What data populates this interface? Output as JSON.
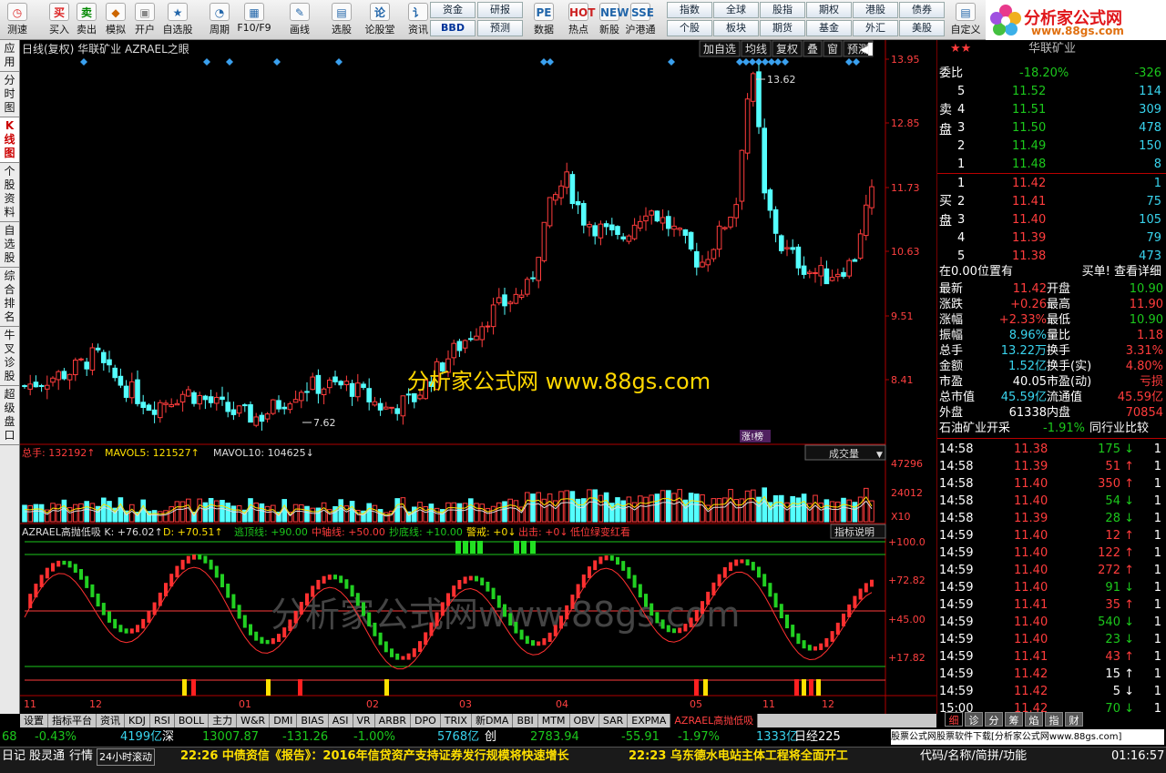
{
  "toolbar": {
    "buttons": [
      "测速",
      "买入",
      "卖出",
      "模拟",
      "开户",
      "自选股",
      "周期",
      "F10/F9",
      "画线",
      "选股",
      "论股堂",
      "资讯",
      "数据",
      "热点",
      "新股",
      "沪港通",
      "自定义"
    ],
    "grid1": [
      "资金",
      "研报",
      "BBD",
      "预测"
    ],
    "grid2": [
      "指数",
      "全球",
      "股指",
      "期权",
      "港股",
      "债券",
      "个股",
      "板块",
      "期货",
      "基金",
      "外汇",
      "美股"
    ],
    "logo_title": "分析家公式网",
    "logo_url": "www.88gs.com"
  },
  "left_tabs": [
    "应用",
    "分时图",
    "K线图",
    "个股资料",
    "自选股",
    "综合排名",
    "牛叉诊股",
    "超级盘口"
  ],
  "chart": {
    "title": "日线(复权) 华联矿业 AZRAEL之眼",
    "menu": [
      "加自选",
      "均线",
      "复权",
      "叠",
      "窗",
      "预测"
    ],
    "price_labels": [
      "13.95",
      "12.85",
      "11.73",
      "10.63",
      "9.51",
      "8.41"
    ],
    "hi_label": "13.62",
    "lo_label": "7.62",
    "watermark": "分析家公式网 www.88gs.com",
    "watermark2": "分析家公式网www.88gs.com",
    "tag": "涨!榜",
    "vol_legend": [
      "总手: 132192↑",
      "MAVOL5: 121527↑",
      "MAVOL10: 104625↓"
    ],
    "vol_select": "成交量",
    "vol_labels": [
      "47296",
      "24012",
      "X10"
    ],
    "ind_legend": [
      "AZRAEL高抛低吸 K: +76.02↑",
      "D: +70.51↑",
      "逃顶线: +90.00",
      "中轴线: +50.00",
      "抄底线: +10.00",
      "警戒: +0↓",
      "出击: +0↓",
      "低位绿变红看"
    ],
    "ind_btn": "指标说明",
    "ind_labels": [
      "+100.0",
      "+72.82",
      "+45.00",
      "+17.82"
    ],
    "months": [
      "11",
      "12",
      "01",
      "02",
      "03",
      "04",
      "05",
      "11",
      "12"
    ]
  },
  "bottom_tabs": [
    "设置",
    "指标平台",
    "资讯",
    "KDJ",
    "RSI",
    "BOLL",
    "主力",
    "W&R",
    "DMI",
    "BIAS",
    "ASI",
    "VR",
    "ARBR",
    "DPO",
    "TRIX",
    "新DMA",
    "BBI",
    "MTM",
    "OBV",
    "SAR",
    "EXPMA",
    "AZRAEL高抛低吸"
  ],
  "right": {
    "header": "华联矿业",
    "wb": [
      "委比",
      "-18.20%",
      "-326"
    ],
    "sell": [
      [
        "5",
        "11.52",
        "114"
      ],
      [
        "4",
        "11.51",
        "309"
      ],
      [
        "3",
        "11.50",
        "478"
      ],
      [
        "2",
        "11.49",
        "150"
      ],
      [
        "1",
        "11.48",
        "8"
      ]
    ],
    "buy": [
      [
        "1",
        "11.42",
        "1"
      ],
      [
        "2",
        "11.41",
        "75"
      ],
      [
        "3",
        "11.40",
        "105"
      ],
      [
        "4",
        "11.39",
        "79"
      ],
      [
        "5",
        "11.38",
        "473"
      ]
    ],
    "sell_label": "卖盘",
    "buy_label": "买盘",
    "pos": "在0.00位置有",
    "pos_link": "买单! 查看详细",
    "stats": [
      [
        "最新",
        "11.42",
        "开盘",
        "10.90"
      ],
      [
        "涨跌",
        "+0.26",
        "最高",
        "11.90"
      ],
      [
        "涨幅",
        "+2.33%",
        "最低",
        "10.90"
      ],
      [
        "振幅",
        "8.96%",
        "量比",
        "1.18"
      ],
      [
        "总手",
        "13.22万",
        "换手",
        "3.31%"
      ],
      [
        "金额",
        "1.52亿",
        "换手(实)",
        "4.80%"
      ],
      [
        "市盈",
        "40.05",
        "市盈(动)",
        "亏损"
      ],
      [
        "总市值",
        "45.59亿",
        "流通值",
        "45.59亿"
      ],
      [
        "外盘",
        "61338",
        "内盘",
        "70854"
      ]
    ],
    "sector": [
      "石油矿业开采",
      "-1.91%",
      "同行业比较"
    ],
    "ticks": [
      [
        "14:58",
        "11.38",
        "175",
        "1"
      ],
      [
        "14:58",
        "11.39",
        "51",
        "1"
      ],
      [
        "14:58",
        "11.40",
        "350",
        "1"
      ],
      [
        "14:58",
        "11.40",
        "54",
        "1"
      ],
      [
        "14:58",
        "11.39",
        "28",
        "1"
      ],
      [
        "14:59",
        "11.40",
        "12",
        "1"
      ],
      [
        "14:59",
        "11.40",
        "122",
        "1"
      ],
      [
        "14:59",
        "11.40",
        "272",
        "1"
      ],
      [
        "14:59",
        "11.40",
        "91",
        "1"
      ],
      [
        "14:59",
        "11.41",
        "35",
        "1"
      ],
      [
        "14:59",
        "11.40",
        "540",
        "1"
      ],
      [
        "14:59",
        "11.40",
        "23",
        "1"
      ],
      [
        "14:59",
        "11.41",
        "43",
        "1"
      ],
      [
        "14:59",
        "11.42",
        "15",
        "1"
      ],
      [
        "14:59",
        "11.42",
        "5",
        "1"
      ],
      [
        "15:00",
        "11.42",
        "70",
        "1"
      ]
    ],
    "tabs": [
      "细",
      "诊",
      "分",
      "筹",
      "焰",
      "指",
      "财"
    ]
  },
  "indexbar": [
    "68",
    "-0.43%",
    "4199亿",
    "深",
    "13007.87",
    "-131.26",
    "-1.00%",
    "5768亿",
    "创",
    "2783.94",
    "-55.91",
    "-1.97%",
    "1333亿",
    "日经225",
    "股票公式网股票软件下载[分析家公式网www.88gs.com]"
  ],
  "news": [
    "日记",
    "股灵通",
    "行情",
    "24小时滚动",
    "22:26 中债资信《报告》：2016年信贷资产支持证券发行规模将快速增长",
    "22:23 乌东德水电站主体工程将全面开工",
    "代码/名称/简拼/功能",
    "01:16:57"
  ]
}
